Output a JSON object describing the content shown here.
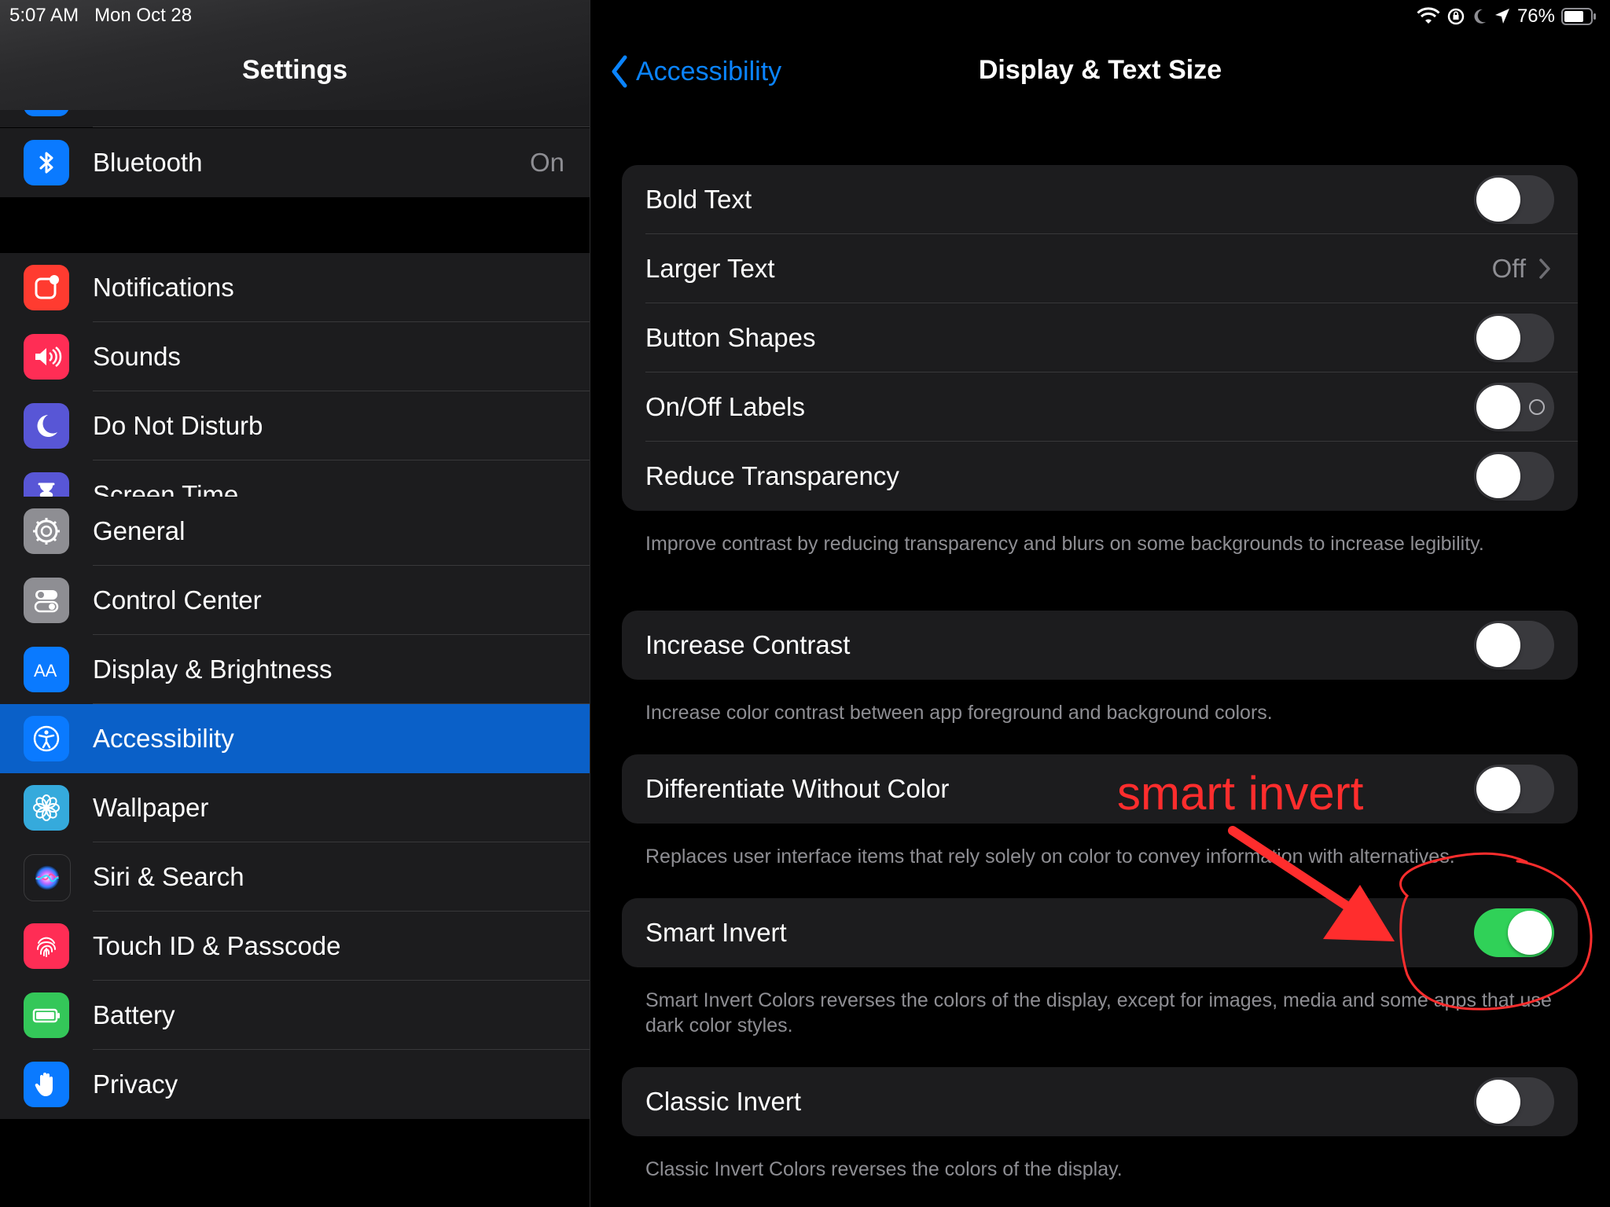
{
  "status": {
    "time": "5:07 AM",
    "date": "Mon Oct 28",
    "battery": "76%"
  },
  "sidebar": {
    "title": "Settings",
    "groups": [
      [
        {
          "label": "Bluetooth",
          "value": "On",
          "icon": "bluetooth-icon",
          "color": "#0a7aff"
        }
      ],
      [
        {
          "label": "Notifications",
          "icon": "notifications-icon",
          "color": "#ff3b30"
        },
        {
          "label": "Sounds",
          "icon": "speaker-icon",
          "color": "#ff2d55"
        },
        {
          "label": "Do Not Disturb",
          "icon": "moon-icon",
          "color": "#5856d6"
        },
        {
          "label": "Screen Time",
          "icon": "hourglass-icon",
          "color": "#5856d6"
        }
      ],
      [
        {
          "label": "General",
          "icon": "gear-icon",
          "color": "#8e8e93"
        },
        {
          "label": "Control Center",
          "icon": "switches-icon",
          "color": "#8e8e93"
        },
        {
          "label": "Display & Brightness",
          "icon": "text-size-icon",
          "color": "#0a7aff"
        },
        {
          "label": "Accessibility",
          "icon": "accessibility-icon",
          "color": "#0a7aff",
          "selected": true
        },
        {
          "label": "Wallpaper",
          "icon": "flower-icon",
          "color": "#35aadc"
        },
        {
          "label": "Siri & Search",
          "icon": "siri-icon",
          "color": "#1c1c1e"
        },
        {
          "label": "Touch ID & Passcode",
          "icon": "fingerprint-icon",
          "color": "#ff2d55"
        },
        {
          "label": "Battery",
          "icon": "battery-icon",
          "color": "#34c759"
        },
        {
          "label": "Privacy",
          "icon": "hand-icon",
          "color": "#0a7aff"
        }
      ]
    ]
  },
  "detail": {
    "back_label": "Accessibility",
    "title": "Display & Text Size",
    "sections": [
      {
        "rows": [
          {
            "label": "Bold Text",
            "type": "toggle",
            "on": false
          },
          {
            "label": "Larger Text",
            "type": "link",
            "value": "Off"
          },
          {
            "label": "Button Shapes",
            "type": "toggle",
            "on": false
          },
          {
            "label": "On/Off Labels",
            "type": "toggle",
            "on": false,
            "onoff": true
          },
          {
            "label": "Reduce Transparency",
            "type": "toggle",
            "on": false
          }
        ],
        "footer": "Improve contrast by reducing transparency and blurs on some backgrounds to increase legibility."
      },
      {
        "rows": [
          {
            "label": "Increase Contrast",
            "type": "toggle",
            "on": false
          }
        ],
        "footer": "Increase color contrast between app foreground and background colors."
      },
      {
        "rows": [
          {
            "label": "Differentiate Without Color",
            "type": "toggle",
            "on": false
          }
        ],
        "footer": "Replaces user interface items that rely solely on color to convey information with alternatives."
      },
      {
        "rows": [
          {
            "label": "Smart Invert",
            "type": "toggle",
            "on": true
          }
        ],
        "footer": "Smart Invert Colors reverses the colors of the display, except for images, media and some apps that use dark color styles."
      },
      {
        "rows": [
          {
            "label": "Classic Invert",
            "type": "toggle",
            "on": false
          }
        ],
        "footer": "Classic Invert Colors reverses the colors of the display."
      }
    ]
  },
  "annotation": {
    "text": "smart invert",
    "color": "#ff2d2d"
  }
}
